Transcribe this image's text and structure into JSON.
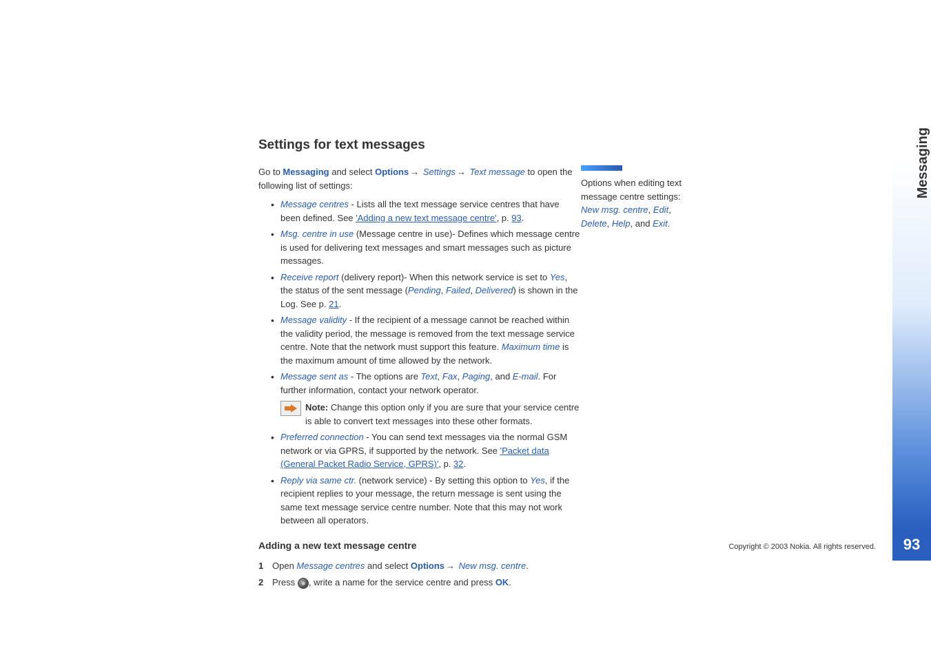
{
  "page": {
    "section_tab": "Messaging",
    "page_number": "93",
    "copyright": "Copyright © 2003 Nokia. All rights reserved."
  },
  "section_title": "Settings for text messages",
  "intro": {
    "prefix": "Go to ",
    "messaging": "Messaging",
    "and_select": " and select ",
    "options": "Options",
    "settings": "Settings",
    "text_message": "Text message",
    "suffix": " to open the following list of settings:"
  },
  "bullets": {
    "b1": {
      "label": "Message centres",
      "text1": " - Lists all the text message service centres that have been defined. See ",
      "link": "'Adding a new text message centre'",
      "text2": ", p. ",
      "page_link": "93",
      "text3": "."
    },
    "b2": {
      "label": "Msg. centre in use",
      "text": " (Message centre in use)- Defines which message centre is used for delivering text messages and smart messages such as picture messages."
    },
    "b3": {
      "label": "Receive report",
      "text1": " (delivery report)- When this network service is set to ",
      "yes": "Yes",
      "text2": ", the status of the sent message (",
      "pending": "Pending",
      "sep1": ", ",
      "failed": "Failed",
      "sep2": ", ",
      "delivered": "Delivered",
      "text3": ") is shown in the Log. See p. ",
      "page_link": "21",
      "text4": "."
    },
    "b4": {
      "label": "Message validity",
      "text1": " - If the recipient of a message cannot be reached within the validity period, the message is removed from the text message service centre. Note that the network must support this feature. ",
      "max_time": "Maximum time",
      "text2": " is the maximum amount of time allowed by the network."
    },
    "b5": {
      "label": "Message sent as",
      "text1": " - The options are ",
      "opt_text": "Text",
      "sep1": ", ",
      "opt_fax": "Fax",
      "sep2": ", ",
      "opt_paging": "Paging",
      "sep3": ", and ",
      "opt_email": "E-mail",
      "text2": ". For further information, contact your network operator.",
      "note_label": "Note:",
      "note_text": " Change this option only if you are sure that your service centre is able to convert text messages into these other formats."
    },
    "b6": {
      "label": "Preferred connection",
      "text1": " - You can send text messages via the normal GSM network or via GPRS, if supported by the network. See ",
      "link": "'Packet data (General Packet Radio Service, GPRS)'",
      "text2": ", p. ",
      "page_link": "32",
      "text3": "."
    },
    "b7": {
      "label": "Reply via same ctr.",
      "text1": " (network service) - By setting this option to ",
      "yes": "Yes",
      "text2": ", if the recipient replies to your message, the return message is sent using the same text message service centre number. Note that this may not work between all operators."
    }
  },
  "subsection_title": "Adding a new text message centre",
  "steps": {
    "s1": {
      "num": "1",
      "text1": "Open ",
      "msg_centres": "Message centres",
      "text2": " and select ",
      "options": "Options",
      "new_centre": "New msg. centre",
      "text3": "."
    },
    "s2": {
      "num": "2",
      "text1": "Press ",
      "text2": ", write a name for the service centre and press ",
      "ok": "OK",
      "text3": "."
    }
  },
  "sidebar": {
    "text1": "Options when editing text message centre settings: ",
    "opt_new": "New msg. centre",
    "sep1": ", ",
    "opt_edit": "Edit",
    "sep2": ", ",
    "opt_delete": "Delete",
    "sep3": ", ",
    "opt_help": "Help",
    "sep4": ", and ",
    "opt_exit": "Exit",
    "text2": "."
  }
}
